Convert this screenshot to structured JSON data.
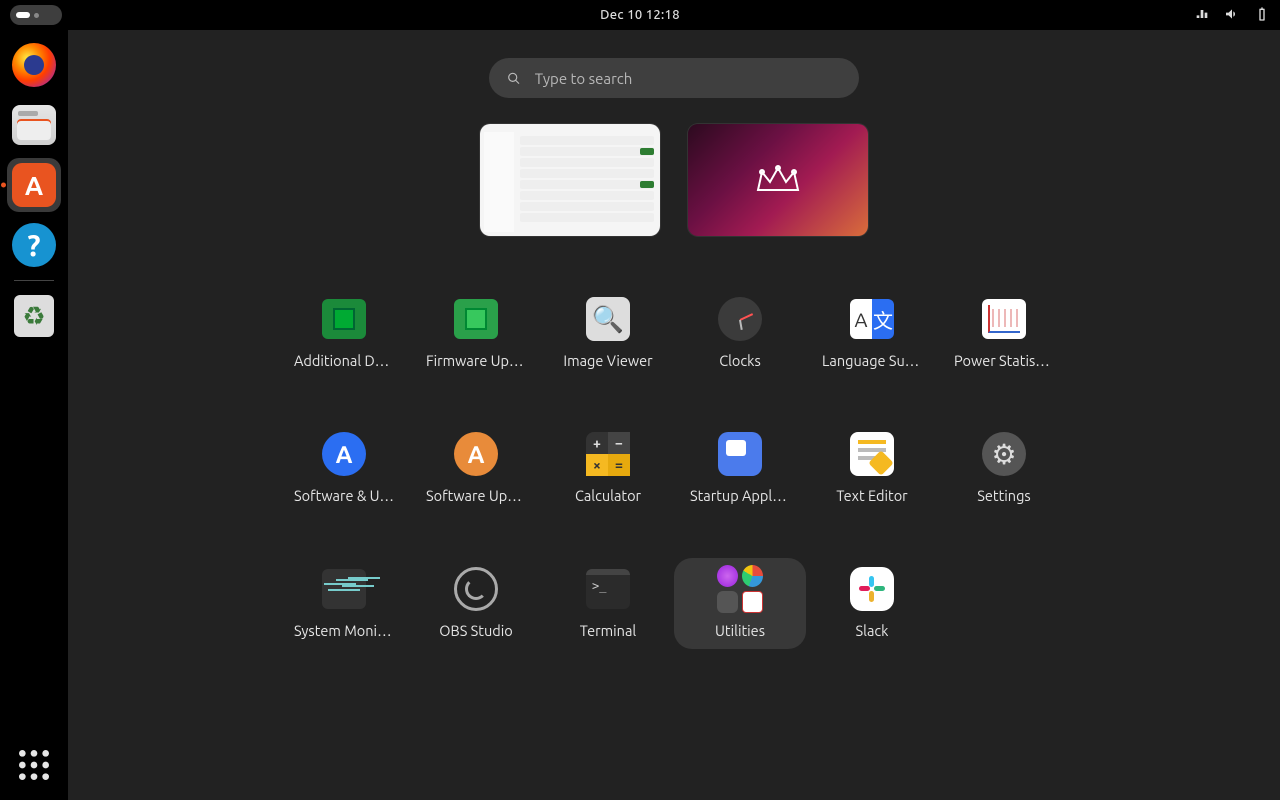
{
  "topbar": {
    "datetime": "Dec 10  12:18"
  },
  "search": {
    "placeholder": "Type to search"
  },
  "dock": {
    "items": [
      {
        "name": "firefox",
        "label": "Firefox"
      },
      {
        "name": "files",
        "label": "Files"
      },
      {
        "name": "software",
        "label": "Ubuntu Software"
      },
      {
        "name": "help",
        "label": "Help"
      },
      {
        "name": "trash",
        "label": "Trash"
      }
    ],
    "show_apps_label": "Show Applications"
  },
  "workspaces": [
    {
      "name": "workspace-1",
      "desc": "Ubuntu Software – Manage Installed Snaps"
    },
    {
      "name": "workspace-2",
      "desc": "Empty desktop with Ubuntu wallpaper"
    }
  ],
  "apps": [
    {
      "id": "additional-drivers",
      "label": "Additional Drivers"
    },
    {
      "id": "firmware-updater",
      "label": "Firmware Updater"
    },
    {
      "id": "image-viewer",
      "label": "Image Viewer"
    },
    {
      "id": "clocks",
      "label": "Clocks"
    },
    {
      "id": "language-support",
      "label": "Language Support"
    },
    {
      "id": "power-statistics",
      "label": "Power Statistics"
    },
    {
      "id": "software-properties",
      "label": "Software & Updates"
    },
    {
      "id": "software-updater",
      "label": "Software Updater"
    },
    {
      "id": "calculator",
      "label": "Calculator"
    },
    {
      "id": "startup-apps",
      "label": "Startup Applications"
    },
    {
      "id": "text-editor",
      "label": "Text Editor"
    },
    {
      "id": "settings",
      "label": "Settings"
    },
    {
      "id": "system-monitor",
      "label": "System Monitor"
    },
    {
      "id": "obs-studio",
      "label": "OBS Studio"
    },
    {
      "id": "terminal",
      "label": "Terminal"
    },
    {
      "id": "utilities",
      "label": "Utilities"
    },
    {
      "id": "slack",
      "label": "Slack"
    }
  ]
}
